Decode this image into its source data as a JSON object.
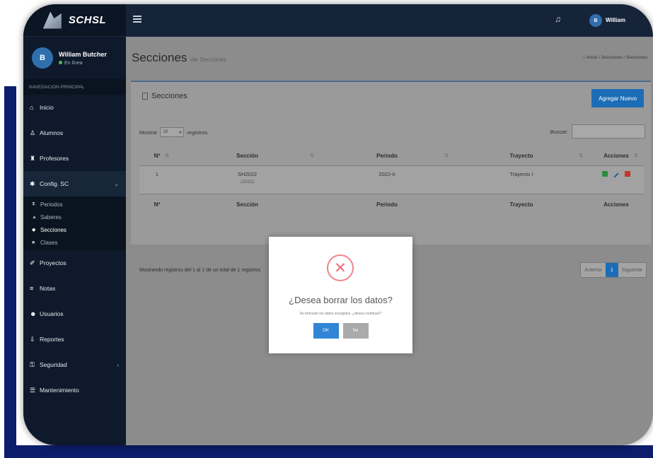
{
  "app": {
    "logo": "SCHSL"
  },
  "user": {
    "initial": "B",
    "name": "William Butcher",
    "status": "En línea"
  },
  "sidebar": {
    "header": "NAVEGACION PRINCIPAL",
    "items": [
      {
        "icon": "⌂",
        "label": "Inicio"
      },
      {
        "icon": "♙",
        "label": "Alumnos"
      },
      {
        "icon": "♜",
        "label": "Profesores"
      }
    ],
    "config": {
      "icon": "✱",
      "label": "Config. SC",
      "caret": "⌄"
    },
    "subitems": [
      {
        "icon": "⧗",
        "label": "Periodos"
      },
      {
        "icon": "▲",
        "label": "Saberes"
      },
      {
        "icon": "◆",
        "label": "Secciones"
      },
      {
        "icon": "■",
        "label": "Clases"
      }
    ],
    "items2": [
      {
        "icon": "✐",
        "label": "Proyectos"
      },
      {
        "icon": "≡",
        "label": "Notas"
      },
      {
        "icon": "☻",
        "label": "Usuarios"
      },
      {
        "icon": "⇩",
        "label": "Reportes"
      },
      {
        "icon": "⚿",
        "label": "Seguridad",
        "caret": "‹"
      },
      {
        "icon": "☰",
        "label": "Mantenimiento"
      }
    ]
  },
  "topbar": {
    "bell": "♫",
    "avatar": "B",
    "user": "William"
  },
  "page": {
    "title": "Secciones",
    "subtitle": "Ver Secciones",
    "breadcrumb": "⌂ Inicio / Secciones / Secciones"
  },
  "card": {
    "title": "Secciones",
    "add_button": "Agregar Nuevo",
    "show_label": "Mostrar",
    "show_value": "10",
    "records_label": "registros",
    "search_label": "Buscar:",
    "columns": [
      "Nº",
      "Sección",
      "Periodo",
      "Trayecto",
      "Acciones"
    ],
    "rows": [
      {
        "n": "1",
        "seccion": "SH2022",
        "seccion_sub": "(2022)",
        "periodo": "2022-II",
        "trayecto": "Trayecto I"
      }
    ],
    "info": "Mostrando registros del 1 al 1 de un total de 1 registros",
    "pager": {
      "prev": "Anterior",
      "current": "1",
      "next": "Siguiente"
    }
  },
  "modal": {
    "icon": "✕",
    "title": "¿Desea borrar los datos?",
    "text": "Se borrarán los datos escogidos. ¿desea continuar?",
    "ok": "OK",
    "no": "No"
  }
}
